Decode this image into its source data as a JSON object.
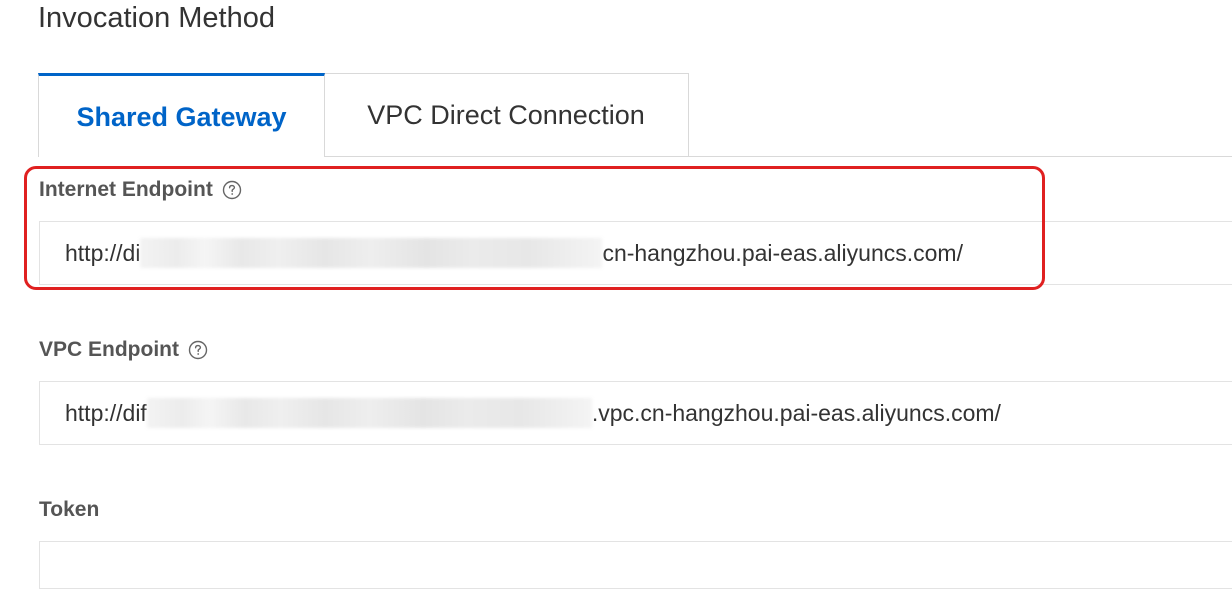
{
  "section": {
    "title": "Invocation Method"
  },
  "tabs": [
    {
      "label": "Shared Gateway",
      "active": true
    },
    {
      "label": "VPC Direct Connection",
      "active": false
    }
  ],
  "fields": {
    "internet_endpoint": {
      "label": "Internet Endpoint",
      "help_icon": "question-circle-icon",
      "value_prefix": "http://di",
      "value_suffix": "cn-hangzhou.pai-eas.aliyuncs.com/"
    },
    "vpc_endpoint": {
      "label": "VPC Endpoint",
      "help_icon": "question-circle-icon",
      "value_prefix": "http://dif",
      "value_suffix": ".vpc.cn-hangzhou.pai-eas.aliyuncs.com/"
    },
    "token": {
      "label": "Token",
      "value": ""
    }
  },
  "colors": {
    "accent": "#0064c8",
    "highlight_border": "#e02020",
    "border": "#d9d9d9",
    "text": "#333333"
  }
}
